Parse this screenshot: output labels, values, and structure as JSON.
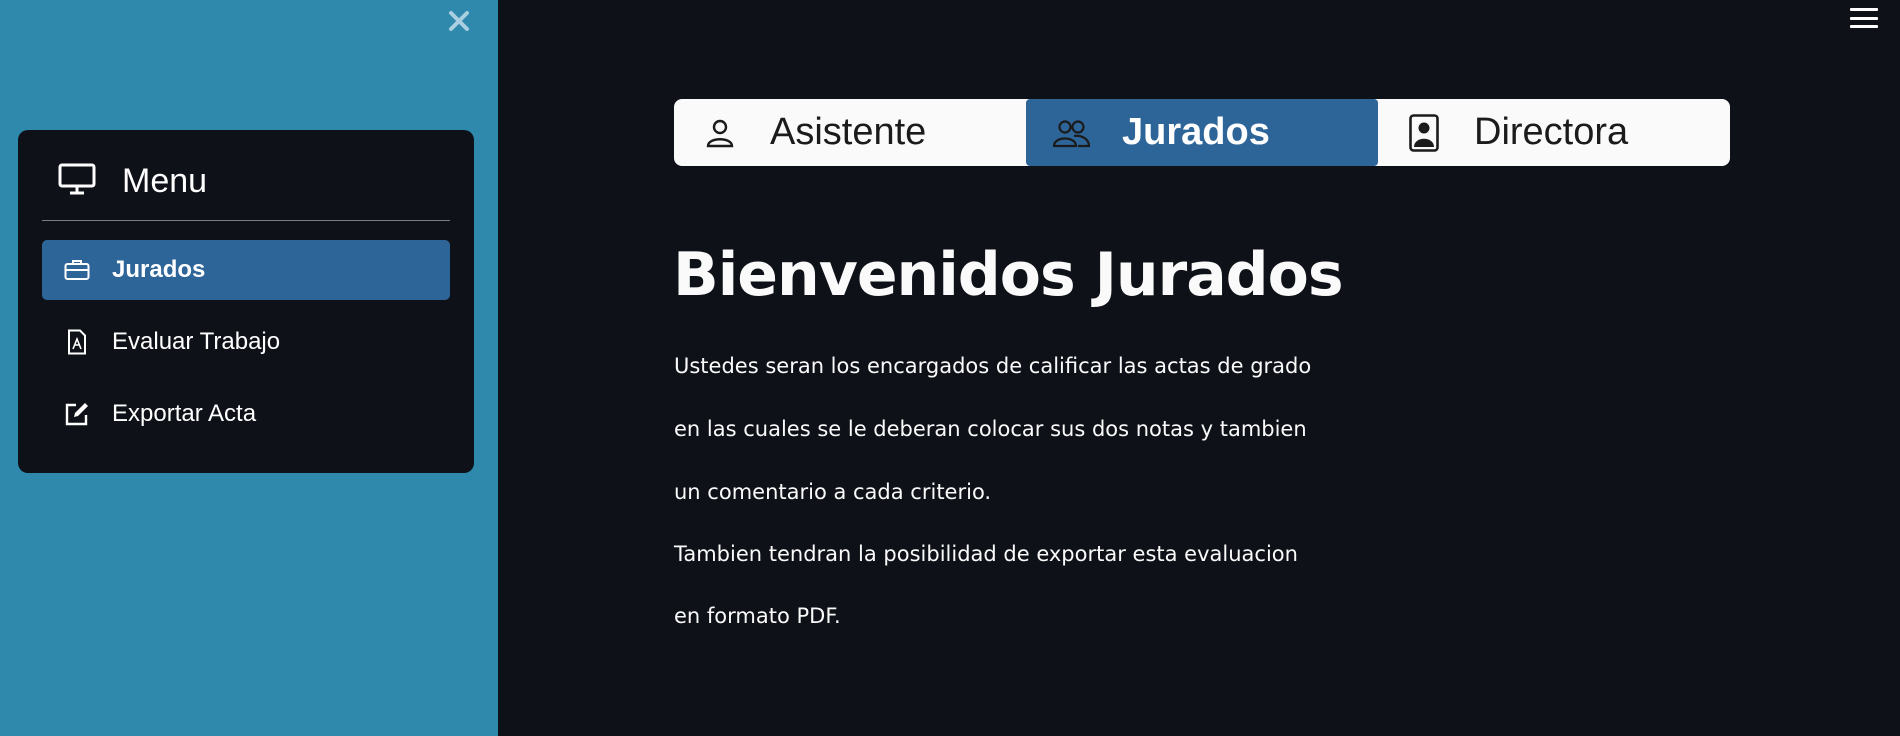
{
  "sidebar": {
    "close_icon": "close-icon",
    "menu_title": "Menu",
    "menu_icon": "monitor-icon",
    "items": [
      {
        "label": "Jurados",
        "icon": "briefcase-icon",
        "active": true
      },
      {
        "label": "Evaluar Trabajo",
        "icon": "pdf-file-icon",
        "active": false
      },
      {
        "label": "Exportar Acta",
        "icon": "edit-icon",
        "active": false
      }
    ],
    "background_color": "#2e89ad",
    "active_color": "#2e6599"
  },
  "tabs": [
    {
      "label": "Asistente",
      "icon": "person-icon",
      "active": false
    },
    {
      "label": "Jurados",
      "icon": "people-icon",
      "active": true
    },
    {
      "label": "Directora",
      "icon": "person-badge-icon",
      "active": false
    }
  ],
  "main": {
    "title": "Bienvenidos Jurados",
    "paragraphs": [
      "Ustedes seran los encargados de calificar las actas de grado",
      "en las cuales se le deberan colocar sus dos notas y tambien",
      "un comentario a cada criterio.",
      "Tambien tendran la posibilidad de exportar esta evaluacion",
      "en formato PDF."
    ]
  },
  "header": {
    "menu_icon": "hamburger-icon"
  }
}
